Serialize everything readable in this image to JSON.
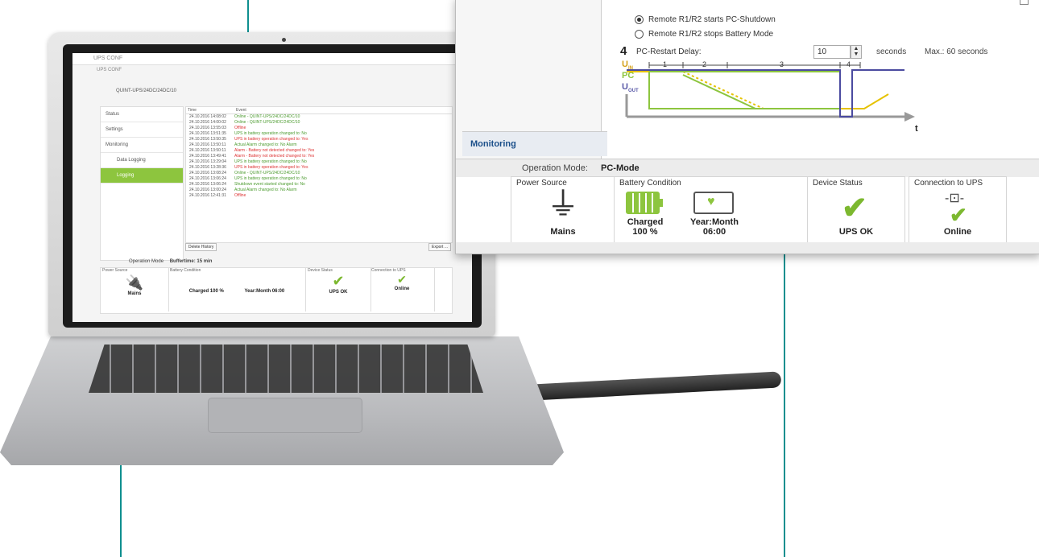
{
  "colors": {
    "accent_green": "#8dc53e",
    "teal": "#0f8f8f",
    "nav_blue": "#1b4f8a"
  },
  "big_window": {
    "nav": {
      "monitoring": "Monitoring"
    },
    "options": {
      "radio1": "Remote R1/R2 starts PC-Shutdown",
      "radio2": "Remote R1/R2 stops Battery Mode"
    },
    "step": "4",
    "delay_label": "PC-Restart Delay:",
    "delay_value": "10",
    "delay_unit": "seconds",
    "delay_max": "Max.: 60 seconds",
    "diagram": {
      "y_labels": [
        "U",
        "IN",
        "PC",
        "U",
        "OUT"
      ],
      "phases": [
        "1",
        "2",
        "3",
        "4"
      ],
      "x_label": "t"
    },
    "operation_mode_label": "Operation Mode:",
    "operation_mode_value": "PC-Mode",
    "power_source": {
      "label": "Power Source",
      "value": "Mains"
    },
    "battery": {
      "label": "Battery Condition",
      "charged": "Charged",
      "percent": "100 %",
      "ym_label": "Year:Month",
      "ym_value": "06:00"
    },
    "device_status": {
      "label": "Device Status",
      "value": "UPS OK"
    },
    "connection": {
      "label": "Connection to UPS",
      "value": "Online"
    }
  },
  "mini_app": {
    "title": "UPS CONF",
    "device": "QUINT-UPS/24DC/24DC/10",
    "nav": [
      "Status",
      "Settings",
      "Monitoring",
      "Data Logging",
      "Logging"
    ],
    "log_header": [
      "Time",
      "Event"
    ],
    "log_rows": [
      {
        "t": "24.10.2016 14:08:02",
        "e": "Online - QUINT-UPS/24DC/24DC/10",
        "red": false
      },
      {
        "t": "24.10.2016 14:00:02",
        "e": "Online - QUINT-UPS/24DC/24DC/10",
        "red": false
      },
      {
        "t": "24.10.2016 13:55:03",
        "e": "Offline",
        "red": true
      },
      {
        "t": "24.10.2016 13:51:35",
        "e": "UPS in battery operation changed to: No",
        "red": false
      },
      {
        "t": "24.10.2016 13:50:35",
        "e": "UPS in battery operation changed to: Yes",
        "red": true
      },
      {
        "t": "24.10.2016 13:50:11",
        "e": "Actual Alarm changed to: No Alarm",
        "red": false
      },
      {
        "t": "24.10.2016 13:50:11",
        "e": "Alarm - Battery not detected changed to: Yes",
        "red": true
      },
      {
        "t": "24.10.2016 13:49:41",
        "e": "Alarm - Battery not detected changed to: Yes",
        "red": true
      },
      {
        "t": "24.10.2016 13:29:04",
        "e": "UPS in battery operation changed to: No",
        "red": false
      },
      {
        "t": "24.10.2016 13:28:36",
        "e": "UPS in battery operation changed to: Yes",
        "red": true
      },
      {
        "t": "24.10.2016 13:08:24",
        "e": "Online - QUINT-UPS/24DC/24DC/10",
        "red": false
      },
      {
        "t": "24.10.2016 13:06:24",
        "e": "UPS in battery operation changed to: No",
        "red": false
      },
      {
        "t": "24.10.2016 13:06:24",
        "e": "Shutdown event started changed to: No",
        "red": false
      },
      {
        "t": "24.10.2016 13:00:24",
        "e": "Actual Alarm changed to: No Alarm",
        "red": false
      },
      {
        "t": "24.10.2016 12:41:31",
        "e": "Offline",
        "red": true
      }
    ],
    "delete_btn": "Delete History",
    "export_btn": "Export ...",
    "operation_mode": "Operation Mode",
    "operation_mode_value": "Buffertime: 15 min",
    "status_labels": [
      "Power Source",
      "Battery Condition",
      "Device Status",
      "Connection to UPS"
    ],
    "status_values": [
      "Mains",
      "Charged 100 %",
      "Year:Month 06:00",
      "UPS OK",
      "Online"
    ]
  }
}
